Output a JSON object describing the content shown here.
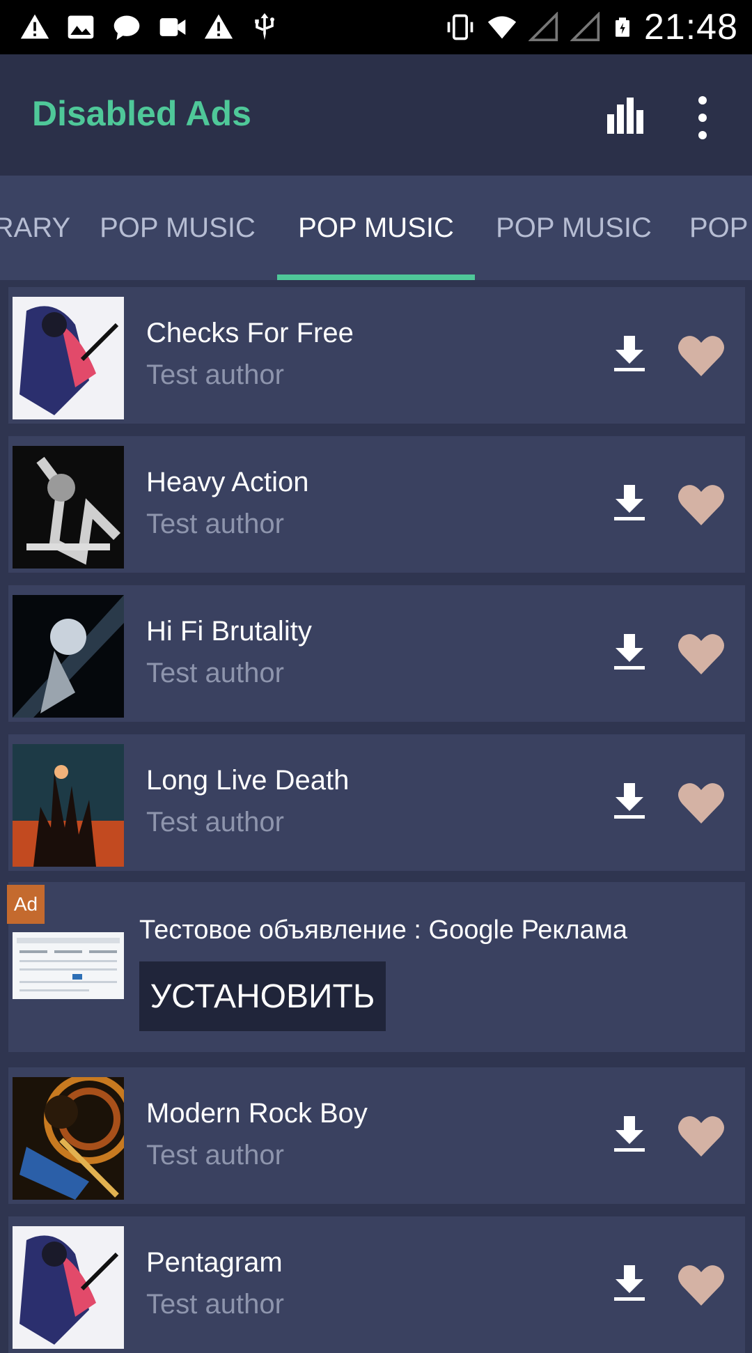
{
  "status_bar": {
    "time": "21:48",
    "left_icons": [
      "warning-icon",
      "image-icon",
      "chat-icon",
      "video-icon",
      "warning-icon",
      "usb-icon"
    ],
    "right_icons": [
      "vibrate-icon",
      "wifi-icon",
      "signal-icon",
      "signal-icon",
      "battery-icon"
    ]
  },
  "app_bar": {
    "title": "Disabled Ads",
    "title_color": "#4fc899",
    "actions": [
      "bar-chart-icon",
      "more-vert-icon"
    ]
  },
  "tabs": [
    {
      "label": "RARY"
    },
    {
      "label": "POP MUSIC"
    },
    {
      "label": "POP MUSIC",
      "active": true
    },
    {
      "label": "POP MUSIC"
    },
    {
      "label": "POP"
    }
  ],
  "tracks": [
    {
      "title": "Checks For Free",
      "author": "Test author"
    },
    {
      "title": "Heavy Action",
      "author": "Test author"
    },
    {
      "title": "Hi Fi Brutality",
      "author": "Test author"
    },
    {
      "title": "Long Live Death",
      "author": "Test author"
    },
    {
      "title": "Modern Rock Boy",
      "author": "Test author"
    },
    {
      "title": "Pentagram",
      "author": "Test author"
    }
  ],
  "ad": {
    "badge": "Ad",
    "title": "Тестовое объявление : Google Реклама",
    "cta": "УСТАНОВИТЬ"
  },
  "colors": {
    "accent": "#4fc899",
    "heart": "#d4b2a4",
    "background": "#2f3550",
    "card": "#3a4160"
  }
}
